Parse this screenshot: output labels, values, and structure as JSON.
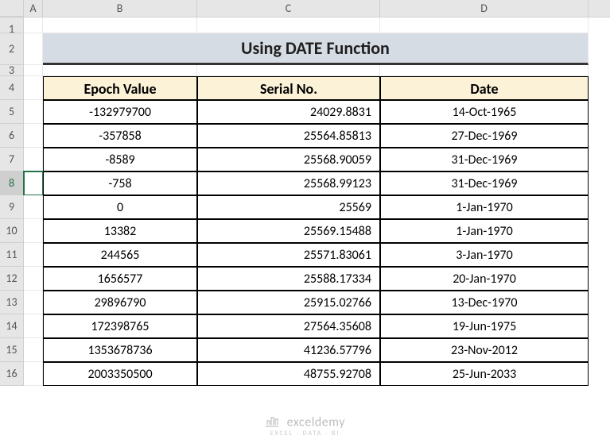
{
  "columns": [
    "A",
    "B",
    "C",
    "D"
  ],
  "rows": [
    "1",
    "2",
    "3",
    "4",
    "5",
    "6",
    "7",
    "8",
    "9",
    "10",
    "11",
    "12",
    "13",
    "14",
    "15",
    "16"
  ],
  "title": "Using DATE Function",
  "headers": {
    "epoch": "Epoch Value",
    "serial": "Serial No.",
    "date": "Date"
  },
  "chart_data": {
    "type": "table",
    "title": "Using DATE Function",
    "columns": [
      "Epoch Value",
      "Serial No.",
      "Date"
    ],
    "rows": [
      {
        "epoch": "-132979700",
        "serial": "24029.8831",
        "date": "14-Oct-1965"
      },
      {
        "epoch": "-357858",
        "serial": "25564.85813",
        "date": "27-Dec-1969"
      },
      {
        "epoch": "-8589",
        "serial": "25568.90059",
        "date": "31-Dec-1969"
      },
      {
        "epoch": "-758",
        "serial": "25568.99123",
        "date": "31-Dec-1969"
      },
      {
        "epoch": "0",
        "serial": "25569",
        "date": "1-Jan-1970"
      },
      {
        "epoch": "13382",
        "serial": "25569.15488",
        "date": "1-Jan-1970"
      },
      {
        "epoch": "244565",
        "serial": "25571.83061",
        "date": "3-Jan-1970"
      },
      {
        "epoch": "1656577",
        "serial": "25588.17334",
        "date": "20-Jan-1970"
      },
      {
        "epoch": "29896790",
        "serial": "25915.02766",
        "date": "13-Dec-1970"
      },
      {
        "epoch": "172398765",
        "serial": "27564.35608",
        "date": "19-Jun-1975"
      },
      {
        "epoch": "1353678736",
        "serial": "41236.57796",
        "date": "23-Nov-2012"
      },
      {
        "epoch": "2003350500",
        "serial": "48755.92708",
        "date": "25-Jun-2033"
      }
    ]
  },
  "logo": {
    "name": "exceldemy",
    "sub": "EXCEL · DATA · BI"
  },
  "selected_row": 8
}
